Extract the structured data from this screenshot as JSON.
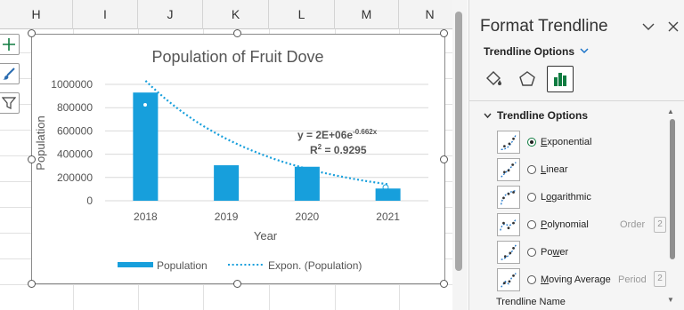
{
  "sheet": {
    "columns": [
      "H",
      "I",
      "J",
      "K",
      "L",
      "M",
      "N"
    ]
  },
  "chart": {
    "title": "Population of Fruit Dove",
    "x_title": "Year",
    "y_title": "Population",
    "legend": {
      "series": "Population",
      "trend": "Expon. (Population)"
    },
    "equation_main": "y = 2E+06e",
    "equation_exp": "-0.662x",
    "r2_label": "R",
    "r2_sup": "2",
    "r2_value": " = 0.9295",
    "colors": {
      "bar": "#179fdc",
      "trend": "#179fdc"
    }
  },
  "chart_data": {
    "type": "bar",
    "title": "Population of Fruit Dove",
    "xlabel": "Year",
    "ylabel": "Population",
    "categories": [
      "2018",
      "2019",
      "2020",
      "2021"
    ],
    "series": [
      {
        "name": "Population",
        "values": [
          930000,
          305000,
          292000,
          105000
        ]
      }
    ],
    "trendline": {
      "name": "Expon. (Population)",
      "type": "exponential",
      "a": 2000000,
      "b": -0.662,
      "r2": 0.9295
    },
    "ylim": [
      0,
      1000000
    ],
    "yticks": [
      "0",
      "200000",
      "400000",
      "600000",
      "800000",
      "1000000"
    ],
    "grid": true,
    "legend": "bottom"
  },
  "pane": {
    "title": "Format Trendline",
    "options_dropdown": "Trendline Options",
    "section_label": "Trendline Options",
    "options": [
      {
        "label": "Exponential",
        "selected": true,
        "u": "E",
        "rest": "xponential"
      },
      {
        "label": "Linear",
        "selected": false,
        "u": "L",
        "rest": "inear"
      },
      {
        "label": "Logarithmic",
        "selected": false,
        "u": "o",
        "pre": "L",
        "rest": "garithmic"
      },
      {
        "label": "Polynomial",
        "selected": false,
        "u": "P",
        "rest": "olynomial"
      },
      {
        "label": "Power",
        "selected": false,
        "pre": "Po",
        "u": "w",
        "rest": "er"
      },
      {
        "label": "Moving Average",
        "selected": false,
        "u": "M",
        "rest": "oving Average"
      }
    ],
    "order_label": "Order",
    "order_value": "2",
    "period_label": "Period",
    "period_value": "2",
    "trendline_name_label": "Trendline Name",
    "icons": {
      "collapse": "chevron-down-icon",
      "close": "close-icon",
      "fill": "paint-bucket-icon",
      "effects": "pentagon-icon",
      "options": "bar-chart-icon"
    }
  }
}
